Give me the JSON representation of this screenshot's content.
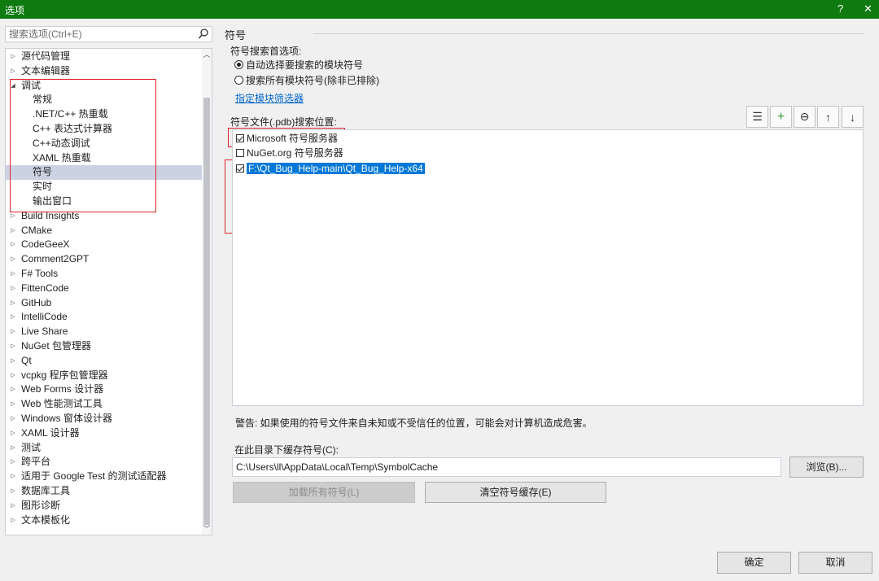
{
  "window": {
    "title": "选项",
    "help_label": "?",
    "close_label": "✕"
  },
  "search": {
    "placeholder": "搜索选项(Ctrl+E)",
    "icon": "search-icon"
  },
  "tree": {
    "items": [
      {
        "label": "源代码管理",
        "level": 0,
        "arrow": "▷"
      },
      {
        "label": "文本编辑器",
        "level": 0,
        "arrow": "▷"
      },
      {
        "label": "调试",
        "level": 0,
        "arrow": "◢"
      },
      {
        "label": "常规",
        "level": 1,
        "arrow": ""
      },
      {
        "label": ".NET/C++ 热重载",
        "level": 1,
        "arrow": ""
      },
      {
        "label": "C++ 表达式计算器",
        "level": 1,
        "arrow": ""
      },
      {
        "label": "C++动态调试",
        "level": 1,
        "arrow": ""
      },
      {
        "label": "XAML 热重载",
        "level": 1,
        "arrow": ""
      },
      {
        "label": "符号",
        "level": 1,
        "arrow": "",
        "selected": true
      },
      {
        "label": "实时",
        "level": 1,
        "arrow": ""
      },
      {
        "label": "输出窗口",
        "level": 1,
        "arrow": ""
      },
      {
        "label": "Build Insights",
        "level": 0,
        "arrow": "▷"
      },
      {
        "label": "CMake",
        "level": 0,
        "arrow": "▷"
      },
      {
        "label": "CodeGeeX",
        "level": 0,
        "arrow": "▷"
      },
      {
        "label": "Comment2GPT",
        "level": 0,
        "arrow": "▷"
      },
      {
        "label": "F# Tools",
        "level": 0,
        "arrow": "▷"
      },
      {
        "label": "FittenCode",
        "level": 0,
        "arrow": "▷"
      },
      {
        "label": "GitHub",
        "level": 0,
        "arrow": "▷"
      },
      {
        "label": "IntelliCode",
        "level": 0,
        "arrow": "▷"
      },
      {
        "label": "Live Share",
        "level": 0,
        "arrow": "▷"
      },
      {
        "label": "NuGet 包管理器",
        "level": 0,
        "arrow": "▷"
      },
      {
        "label": "Qt",
        "level": 0,
        "arrow": "▷"
      },
      {
        "label": "vcpkg 程序包管理器",
        "level": 0,
        "arrow": "▷"
      },
      {
        "label": "Web Forms 设计器",
        "level": 0,
        "arrow": "▷"
      },
      {
        "label": "Web 性能测试工具",
        "level": 0,
        "arrow": "▷"
      },
      {
        "label": "Windows 窗体设计器",
        "level": 0,
        "arrow": "▷"
      },
      {
        "label": "XAML 设计器",
        "level": 0,
        "arrow": "▷"
      },
      {
        "label": "测试",
        "level": 0,
        "arrow": "▷"
      },
      {
        "label": "跨平台",
        "level": 0,
        "arrow": "▷"
      },
      {
        "label": "适用于 Google Test 的测试适配器",
        "level": 0,
        "arrow": "▷"
      },
      {
        "label": "数据库工具",
        "level": 0,
        "arrow": "▷"
      },
      {
        "label": "图形诊断",
        "level": 0,
        "arrow": "▷"
      },
      {
        "label": "文本模板化",
        "level": 0,
        "arrow": "▷"
      }
    ]
  },
  "symbols": {
    "section_title": "符号",
    "search_pref_label": "符号搜索首选项:",
    "radio_options": [
      {
        "label": "自动选择要搜索的模块符号",
        "selected": true
      },
      {
        "label": "搜索所有模块符号(除非已排除)",
        "selected": false
      }
    ],
    "filter_link": "指定模块筛选器",
    "locations_label": "符号文件(.pdb)搜索位置:",
    "toolbar": [
      "list-icon",
      "plus-icon",
      "minus-circle-icon",
      "arrow-up-icon",
      "arrow-down-icon"
    ],
    "toolbar_glyphs": [
      "☰",
      "+",
      "⊖",
      "↑",
      "↓"
    ],
    "locations": [
      {
        "label": "Microsoft 符号服务器",
        "checked": true
      },
      {
        "label": "NuGet.org 符号服务器",
        "checked": false
      },
      {
        "label": "F:\\Qt_Bug_Help-main\\Qt_Bug_Help-x64",
        "checked": true,
        "selected": true
      }
    ],
    "warning": "警告: 如果使用的符号文件来自未知或不受信任的位置，可能会对计算机造成危害。",
    "cache_label": "在此目录下缓存符号(C):",
    "cache_path": "C:\\Users\\ll\\AppData\\Local\\Temp\\SymbolCache",
    "browse_button": "浏览(B)...",
    "load_all_button": "加载所有符号(L)",
    "clear_cache_button": "清空符号缓存(E)"
  },
  "footer": {
    "ok_button": "确定",
    "cancel_button": "取消"
  },
  "colors": {
    "titlebar": "#0e7a10",
    "selection": "#0078d7",
    "annotation": "#e0212a"
  }
}
